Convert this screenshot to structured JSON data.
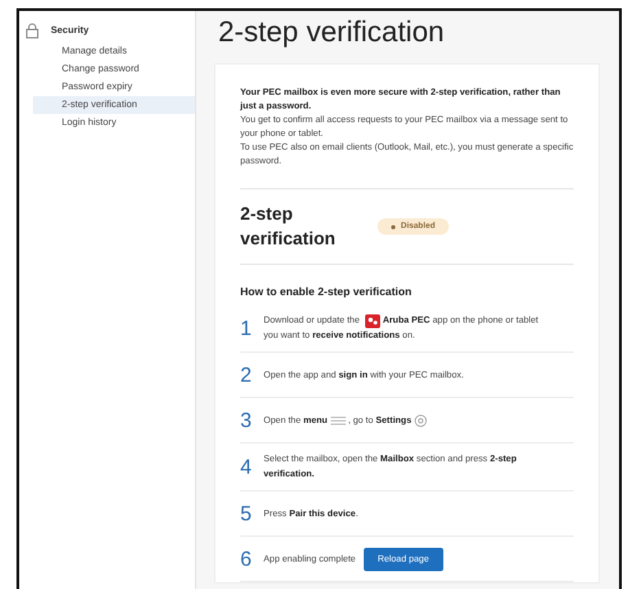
{
  "sidebar": {
    "section": "Security",
    "items": [
      {
        "label": "Manage details",
        "selected": false
      },
      {
        "label": "Change password",
        "selected": false
      },
      {
        "label": "Password expiry",
        "selected": false
      },
      {
        "label": "2-step verification",
        "selected": true
      },
      {
        "label": "Login history",
        "selected": false
      }
    ]
  },
  "page_title": "2-step verification",
  "intro": [
    "**Your PEC mailbox is even more secure with 2-step verification, rather than just a password.**",
    "You get to confirm all access requests to your PEC mailbox via a message sent to your phone or tablet.",
    "To use PEC also on email clients (Outlook, Mail, etc.), you must generate a specific password."
  ],
  "status": {
    "heading": "2-step verification",
    "badge": "Disabled",
    "enabled": false
  },
  "steps_title": "How to enable 2-step verification",
  "steps": [
    {
      "number": "1",
      "parts": [
        {
          "kind": "text",
          "text": "Download or update the "
        },
        {
          "kind": "app-icon"
        },
        {
          "kind": "text",
          "text": "**Aruba PEC** app on the phone or tablet"
        },
        {
          "kind": "break"
        },
        {
          "kind": "text",
          "text": "you want to **receive notifications** on."
        }
      ]
    },
    {
      "number": "2",
      "parts": [
        {
          "kind": "text",
          "text": "Open the app and **sign in** with your PEC mailbox."
        }
      ]
    },
    {
      "number": "3",
      "parts": [
        {
          "kind": "text",
          "text": "Open the **menu**"
        },
        {
          "kind": "menu-icon"
        },
        {
          "kind": "text",
          "text": ", go to **Settings**"
        },
        {
          "kind": "gear-icon"
        }
      ]
    },
    {
      "number": "4",
      "parts": [
        {
          "kind": "text",
          "text": "Select the mailbox, open the **Mailbox** section and press **2-step**"
        },
        {
          "kind": "break"
        },
        {
          "kind": "text",
          "text": "**verification.**"
        }
      ]
    },
    {
      "number": "5",
      "parts": [
        {
          "kind": "text",
          "text": "Press **Pair this device**."
        }
      ]
    },
    {
      "number": "6",
      "parts": [
        {
          "kind": "text",
          "text": "App enabling complete"
        },
        {
          "kind": "button",
          "text": "Reload page"
        }
      ]
    }
  ]
}
